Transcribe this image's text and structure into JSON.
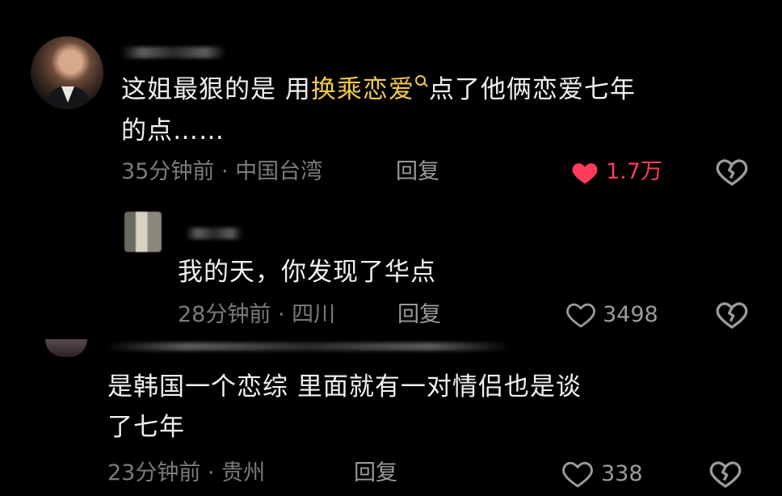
{
  "colors": {
    "background": "#000000",
    "text": "#f1f1f1",
    "meta": "#7b7b7b",
    "highlight": "#f2c94c",
    "liked": "#ff3b5c"
  },
  "comments": [
    {
      "text_before": "这姐最狠的是 用",
      "highlight": "换乘恋爱",
      "search_icon": "search-icon",
      "text_after_line1": "点了他俩恋爱七年",
      "text_line2": "的点……",
      "meta": "35分钟前 · 中国台湾",
      "reply_label": "回复",
      "like_count": "1.7万",
      "liked": true,
      "like_icon": "heart-filled-icon",
      "dislike_icon": "broken-heart-icon"
    },
    {
      "text_line1": "我的天，你发现了华点",
      "meta": "28分钟前 · 四川",
      "reply_label": "回复",
      "like_count": "3498",
      "liked": false,
      "like_icon": "heart-outline-icon",
      "dislike_icon": "broken-heart-icon"
    },
    {
      "text_line1": "是韩国一个恋综 里面就有一对情侣也是谈",
      "text_line2": "了七年",
      "meta": "23分钟前 · 贵州",
      "reply_label": "回复",
      "like_count": "338",
      "liked": false,
      "like_icon": "heart-outline-icon",
      "dislike_icon": "broken-heart-icon"
    }
  ]
}
